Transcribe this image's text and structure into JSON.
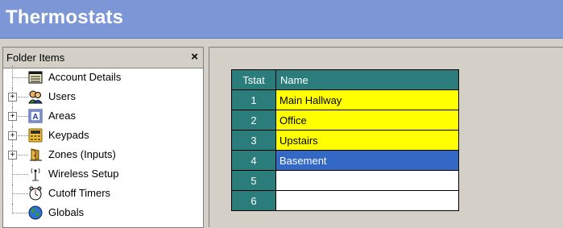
{
  "window": {
    "title": "Thermostats"
  },
  "folder_pane": {
    "header": "Folder Items",
    "close_glyph": "×",
    "items": [
      {
        "label": "Account Details",
        "icon": "account-details-icon",
        "expandable": false
      },
      {
        "label": "Users",
        "icon": "users-icon",
        "expandable": true
      },
      {
        "label": "Areas",
        "icon": "areas-icon",
        "expandable": true
      },
      {
        "label": "Keypads",
        "icon": "keypad-icon",
        "expandable": true
      },
      {
        "label": "Zones (Inputs)",
        "icon": "zones-icon",
        "expandable": true
      },
      {
        "label": "Wireless Setup",
        "icon": "wireless-icon",
        "expandable": false
      },
      {
        "label": "Cutoff Timers",
        "icon": "timer-icon",
        "expandable": false
      },
      {
        "label": "Globals",
        "icon": "globe-icon",
        "expandable": false
      }
    ]
  },
  "table": {
    "columns": [
      "Tstat",
      "Name"
    ],
    "rows": [
      {
        "tstat": "1",
        "name": "Main Hallway",
        "state": "yellow"
      },
      {
        "tstat": "2",
        "name": "Office",
        "state": "yellow"
      },
      {
        "tstat": "3",
        "name": "Upstairs",
        "state": "yellow"
      },
      {
        "tstat": "4",
        "name": "Basement",
        "state": "selected"
      },
      {
        "tstat": "5",
        "name": "",
        "state": "empty"
      },
      {
        "tstat": "6",
        "name": "",
        "state": "empty"
      }
    ]
  },
  "colors": {
    "title_bar": "#7d97d6",
    "grid_header": "#2a7d7a",
    "highlight": "#ffff00",
    "selection": "#3368c4"
  }
}
